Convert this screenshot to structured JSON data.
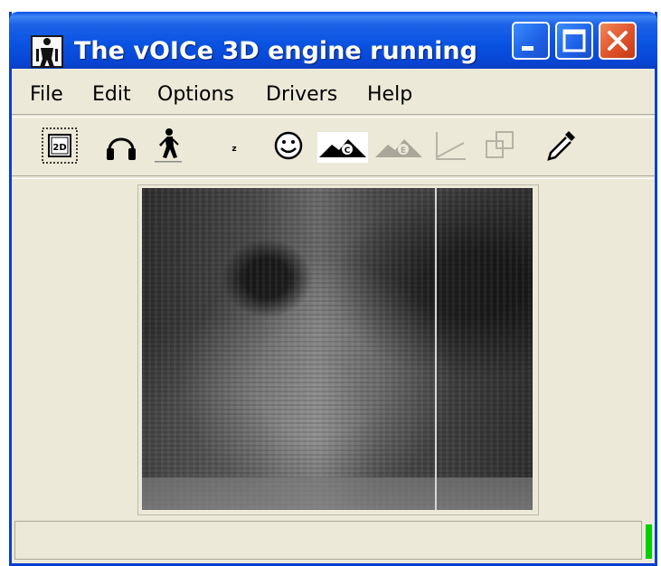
{
  "window": {
    "title": "The vOICe 3D engine running",
    "title_bar_color": "#0a53e2"
  },
  "titlebar_buttons": {
    "minimize_icon": "minimize-icon",
    "maximize_icon": "maximize-icon",
    "close_icon": "close-icon"
  },
  "menu": {
    "items": [
      {
        "label": "File"
      },
      {
        "label": "Edit"
      },
      {
        "label": "Options"
      },
      {
        "label": "Drivers"
      },
      {
        "label": "Help"
      }
    ]
  },
  "toolbar": {
    "items": [
      {
        "icon": "view-2d-icon",
        "text": "2D"
      },
      {
        "icon": "headphones-icon"
      },
      {
        "icon": "walking-person-icon"
      },
      {
        "icon": "small-dot-icon",
        "text": "z"
      },
      {
        "icon": "smiley-face-icon"
      },
      {
        "icon": "landscape-c-icon",
        "text": "C"
      },
      {
        "icon": "landscape-e-icon",
        "text": "E"
      },
      {
        "icon": "line-graph-icon"
      },
      {
        "icon": "overlapping-squares-icon"
      },
      {
        "icon": "eyedropper-icon"
      }
    ]
  },
  "status_bar": {
    "text": "",
    "indicator_color": "#00d000"
  }
}
